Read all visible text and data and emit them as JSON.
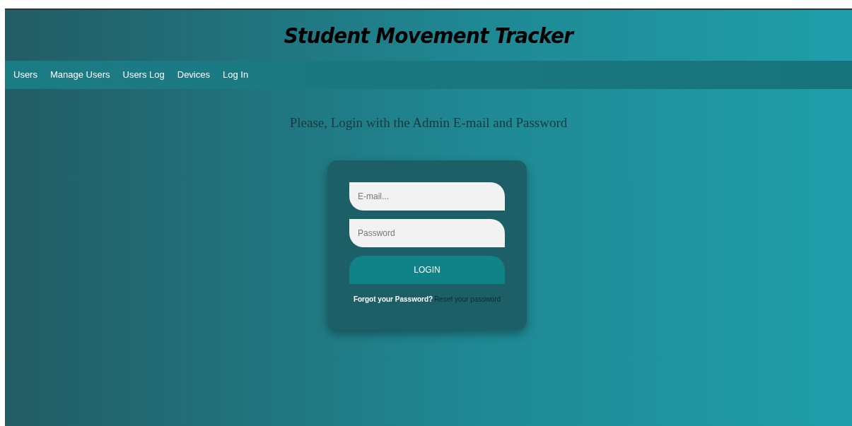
{
  "header": {
    "title": "Student Movement Tracker"
  },
  "nav": [
    {
      "label": "Users"
    },
    {
      "label": "Manage Users"
    },
    {
      "label": "Users Log"
    },
    {
      "label": "Devices"
    },
    {
      "label": "Log In"
    }
  ],
  "prompt": "Please, Login with the Admin E-mail and Password",
  "form": {
    "email": {
      "placeholder": "E-mail..."
    },
    "password": {
      "placeholder": "Password"
    },
    "button": "LOGIN",
    "forgot": "Forgot your Password?",
    "reset_link": "Reset your password"
  }
}
